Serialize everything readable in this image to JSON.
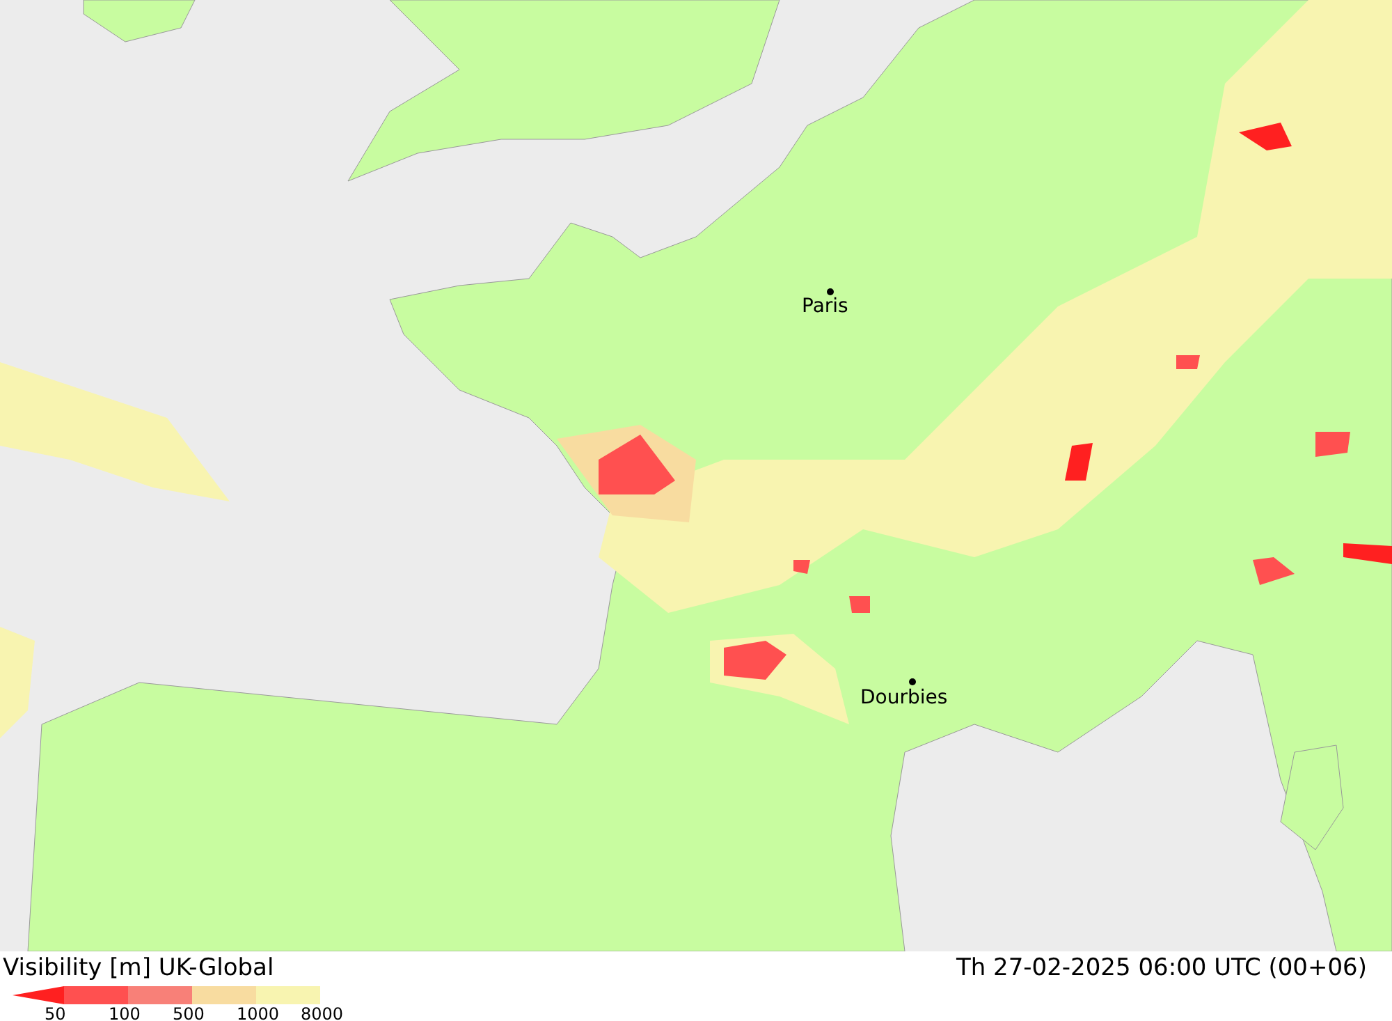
{
  "map": {
    "cities": [
      {
        "name": "Paris"
      },
      {
        "name": "Dourbies"
      }
    ]
  },
  "footer": {
    "title": "Visibility [m] UK-Global",
    "datetime": "Th 27-02-2025 06:00 UTC (00+06)",
    "legend": [
      {
        "label": "50",
        "color": "#ff2020"
      },
      {
        "label": "100",
        "color": "#ff5050"
      },
      {
        "label": "500",
        "color": "#f88078"
      },
      {
        "label": "1000",
        "color": "#f8dca0"
      },
      {
        "label": "8000",
        "color": "#f8f4b0"
      }
    ]
  }
}
